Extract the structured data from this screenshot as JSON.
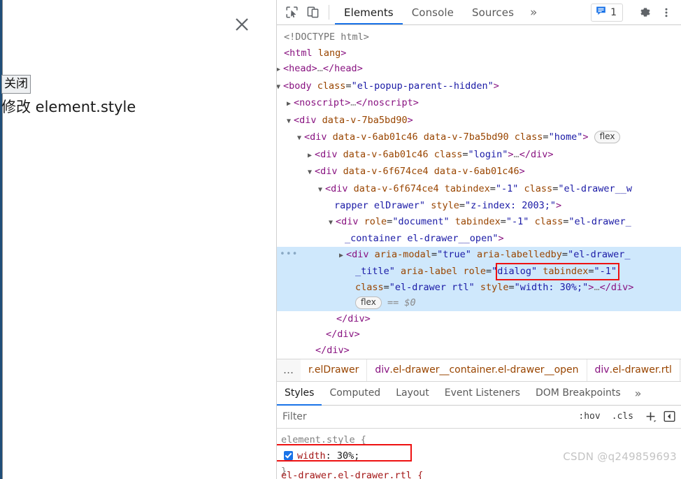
{
  "page": {
    "drawer": {
      "close_icon": "close-x-icon",
      "tooltip_label": "关闭",
      "title": "修改 element.style"
    }
  },
  "devtools": {
    "toolbar": {
      "inspect_icon": "inspect-element-icon",
      "device_toolbar_icon": "device-toolbar-icon",
      "tabs": [
        {
          "label": "Elements",
          "active": true
        },
        {
          "label": "Console",
          "active": false
        },
        {
          "label": "Sources",
          "active": false
        }
      ],
      "more_tabs_label": "»",
      "issues": {
        "icon": "issues-message-icon",
        "count": "1"
      },
      "settings_icon": "gear-icon",
      "more_icon": "three-dots-vertical-icon"
    },
    "dom_tree": {
      "lines": [
        {
          "indent": 0,
          "arrow": "",
          "html": "<span class=\"pt\">&lt;!DOCTYPE html&gt;</span>"
        },
        {
          "indent": 0,
          "arrow": "",
          "html": "<span class=\"tw\">&lt;html</span> <span class=\"an\">lang</span><span class=\"tw\">&gt;</span>"
        },
        {
          "indent": 0,
          "arrow": "right",
          "html": "<span class=\"tw\">&lt;head&gt;</span><span class=\"el\">…</span><span class=\"tw\">&lt;/head&gt;</span>"
        },
        {
          "indent": 0,
          "arrow": "down",
          "html": "<span class=\"tw\">&lt;body</span> <span class=\"an\">class</span>=<span class=\"av\">\"el-popup-parent--hidden\"</span><span class=\"tw\">&gt;</span>"
        },
        {
          "indent": 1,
          "arrow": "right",
          "html": "<span class=\"tw\">&lt;noscript&gt;</span><span class=\"el\">…</span><span class=\"tw\">&lt;/noscript&gt;</span>"
        },
        {
          "indent": 1,
          "arrow": "down",
          "html": "<span class=\"tw\">&lt;div</span> <span class=\"an\">data-v-7ba5bd90</span><span class=\"tw\">&gt;</span>"
        },
        {
          "indent": 2,
          "arrow": "down",
          "html": "<span class=\"tw\">&lt;div</span> <span class=\"an\">data-v-6ab01c46</span> <span class=\"an\">data-v-7ba5bd90</span> <span class=\"an\">class</span>=<span class=\"av\">\"home\"</span><span class=\"tw\">&gt;</span> <span class=\"badge-flex\">flex</span>"
        },
        {
          "indent": 3,
          "arrow": "right",
          "html": "<span class=\"tw\">&lt;div</span> <span class=\"an\">data-v-6ab01c46</span> <span class=\"an\">class</span>=<span class=\"av\">\"login\"</span><span class=\"tw\">&gt;</span><span class=\"el\">…</span><span class=\"tw\">&lt;/div&gt;</span>"
        },
        {
          "indent": 3,
          "arrow": "down",
          "html": "<span class=\"tw\">&lt;div</span> <span class=\"an\">data-v-6f674ce4</span> <span class=\"an\">data-v-6ab01c46</span><span class=\"tw\">&gt;</span>"
        },
        {
          "indent": 4,
          "arrow": "down",
          "html": "<span class=\"tw\">&lt;div</span> <span class=\"an\">data-v-6f674ce4</span> <span class=\"an\">tabindex</span>=<span class=\"av\">\"-1\"</span> <span class=\"an\">class</span>=<span class=\"av\">\"el-drawer__w</span>"
        },
        {
          "indent": 4,
          "arrow": "",
          "cont": true,
          "html": "<span class=\"av\">rapper elDrawer\"</span> <span class=\"an\">style</span>=<span class=\"av\">\"z-index: 2003;\"</span><span class=\"tw\">&gt;</span>"
        },
        {
          "indent": 5,
          "arrow": "down",
          "html": "<span class=\"tw\">&lt;div</span> <span class=\"an\">role</span>=<span class=\"av\">\"document\"</span> <span class=\"an\">tabindex</span>=<span class=\"av\">\"-1\"</span> <span class=\"an\">class</span>=<span class=\"av\">\"el-drawer_</span>"
        },
        {
          "indent": 5,
          "arrow": "",
          "cont": true,
          "html": "<span class=\"av\">_container el-drawer__open\"</span><span class=\"tw\">&gt;</span>"
        },
        {
          "indent": 6,
          "arrow": "right",
          "selected": true,
          "dots": true,
          "html": "<span class=\"tw\">&lt;div</span> <span class=\"an\">aria-modal</span>=<span class=\"av\">\"true\"</span> <span class=\"an\">aria-labelledby</span>=<span class=\"av\">\"el-drawer_</span>"
        },
        {
          "indent": 6,
          "arrow": "",
          "cont": true,
          "selected": true,
          "html": "<span class=\"av\">_title\"</span> <span class=\"an\">aria-label</span> <span class=\"an\">role</span>=<span class=\"av\">\"dialog\"</span> <span class=\"an\">tabindex</span>=<span class=\"av\">\"-1\"</span>"
        },
        {
          "indent": 6,
          "arrow": "",
          "cont": true,
          "selected": true,
          "html": "<span class=\"an\">class</span>=<span class=\"av\">\"el-drawer rtl\"</span> <span class=\"an\">style</span>=<span class=\"av\">\"width: 30%;\"</span><span class=\"tw\">&gt;</span><span class=\"el\">…</span><span class=\"tw\">&lt;/div&gt;</span>"
        },
        {
          "indent": 6,
          "arrow": "",
          "cont": true,
          "selected": true,
          "html": "<span class=\"badge-flex\">flex</span> <span class=\"eqdollar\">== $0</span>"
        },
        {
          "indent": 5,
          "arrow": "",
          "html": "<span class=\"tw\">&lt;/div&gt;</span>"
        },
        {
          "indent": 4,
          "arrow": "",
          "html": "<span class=\"tw\">&lt;/div&gt;</span>"
        },
        {
          "indent": 3,
          "arrow": "",
          "html": "<span class=\"tw\">&lt;/div&gt;</span>"
        }
      ],
      "highlight_box_label": "style-width-30-highlight"
    },
    "breadcrumb": {
      "overflow_label": "…",
      "items": [
        {
          "text": "r.elDrawer",
          "truncated": true
        },
        {
          "tag": "div",
          "cls": ".el-drawer__container.el-drawer__open"
        },
        {
          "tag": "div",
          "cls": ".el-drawer.rtl"
        }
      ]
    },
    "sidebar_tabs": [
      {
        "label": "Styles",
        "active": true
      },
      {
        "label": "Computed",
        "active": false
      },
      {
        "label": "Layout",
        "active": false
      },
      {
        "label": "Event Listeners",
        "active": false
      },
      {
        "label": "DOM Breakpoints",
        "active": false
      }
    ],
    "sidebar_tabs_more": "»",
    "filter": {
      "placeholder": "Filter",
      "value": "",
      "hov_label": ":hov",
      "cls_label": ".cls",
      "new_rule_label": "+",
      "toggle_panel_label": "◧"
    },
    "styles": {
      "element_style_selector": "element.style {",
      "declaration": {
        "enabled": true,
        "property": "width",
        "value": "30%;"
      },
      "close_brace": "}",
      "next_rule_partial": "el-drawer.el-drawer.rtl {",
      "watermark": "CSDN @q249859693"
    }
  }
}
